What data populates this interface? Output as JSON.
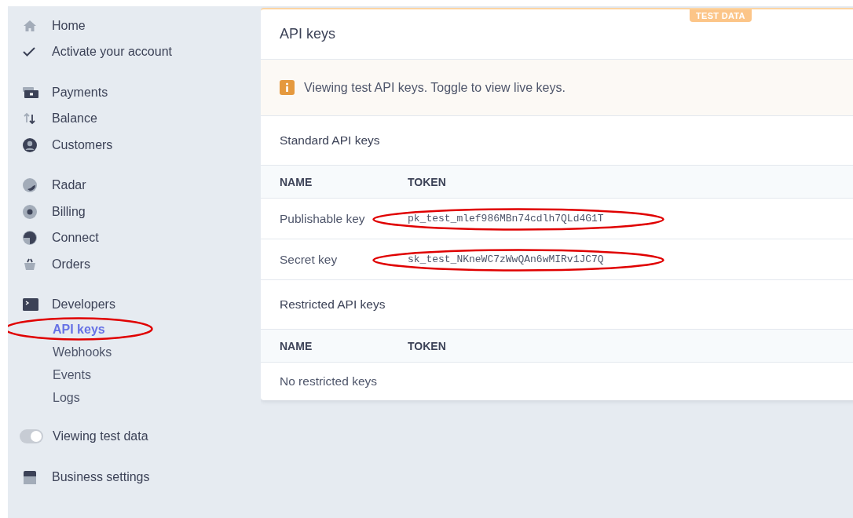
{
  "sidebar": {
    "sections": [
      {
        "items": [
          {
            "kind": "link",
            "label": "Home",
            "selected": false
          },
          {
            "kind": "link",
            "label": "Activate your account",
            "selected": false
          }
        ]
      },
      {
        "items": [
          {
            "kind": "link",
            "label": "Payments",
            "selected": false
          },
          {
            "kind": "link",
            "label": "Balance",
            "selected": false
          },
          {
            "kind": "link",
            "label": "Customers",
            "selected": false
          }
        ]
      },
      {
        "items": [
          {
            "kind": "link",
            "label": "Radar",
            "selected": false
          },
          {
            "kind": "link",
            "label": "Billing",
            "selected": false
          },
          {
            "kind": "link",
            "label": "Connect",
            "selected": false
          },
          {
            "kind": "link",
            "label": "Orders",
            "selected": false
          }
        ]
      },
      {
        "items": [
          {
            "kind": "link",
            "label": "Developers",
            "selected": false,
            "children": [
              {
                "label": "API keys",
                "selected": true,
                "circled": true
              },
              {
                "label": "Webhooks",
                "selected": false,
                "circled": false
              },
              {
                "label": "Events",
                "selected": false,
                "circled": false
              },
              {
                "label": "Logs",
                "selected": false,
                "circled": false
              }
            ]
          }
        ]
      },
      {
        "items": [
          {
            "kind": "toggle",
            "label": "Viewing test data",
            "on": true
          }
        ]
      },
      {
        "items": [
          {
            "kind": "link",
            "label": "Business settings",
            "selected": false
          }
        ]
      }
    ]
  },
  "card": {
    "badge": "TEST DATA",
    "title": "API keys",
    "notice": "Viewing test API keys. Toggle to view live keys.",
    "sections": [
      {
        "title": "Standard API keys",
        "columns": [
          "NAME",
          "TOKEN"
        ],
        "rows": [
          {
            "name": "Publishable key",
            "token": "pk_test_mlef986MBn74cdlh7QLd4G1T",
            "circled": true
          },
          {
            "name": "Secret key",
            "token": "sk_test_NKneWC7zWwQAn6wMIRv1JC7Q",
            "circled": true
          }
        ]
      },
      {
        "title": "Restricted API keys",
        "columns": [
          "NAME",
          "TOKEN"
        ],
        "empty": "No restricted keys"
      }
    ]
  }
}
